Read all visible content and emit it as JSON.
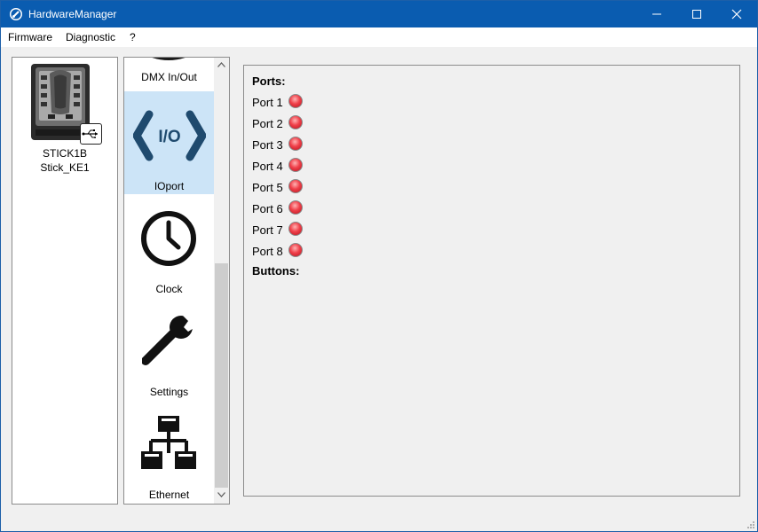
{
  "window": {
    "title": "HardwareManager"
  },
  "menu": {
    "items": [
      "Firmware",
      "Diagnostic",
      "?"
    ]
  },
  "device": {
    "line1": "STICK1B",
    "line2": "Stick_KE1"
  },
  "modules": {
    "items": [
      {
        "label": "DMX In/Out",
        "icon": "dmx-icon"
      },
      {
        "label": "IOport",
        "icon": "io-icon",
        "selected": true
      },
      {
        "label": "Clock",
        "icon": "clock-icon"
      },
      {
        "label": "Settings",
        "icon": "wrench-icon"
      },
      {
        "label": "Ethernet",
        "icon": "network-icon"
      }
    ]
  },
  "ports": {
    "title": "Ports:",
    "items": [
      "Port 1",
      "Port 2",
      "Port 3",
      "Port 4",
      "Port 5",
      "Port 6",
      "Port 7",
      "Port 8"
    ],
    "led_color": "#e8343f"
  },
  "buttons": {
    "title": "Buttons:"
  },
  "colors": {
    "titlebar": "#0a5cb0",
    "selection": "#cce4f7",
    "io_icon": "#1f4a6e"
  }
}
